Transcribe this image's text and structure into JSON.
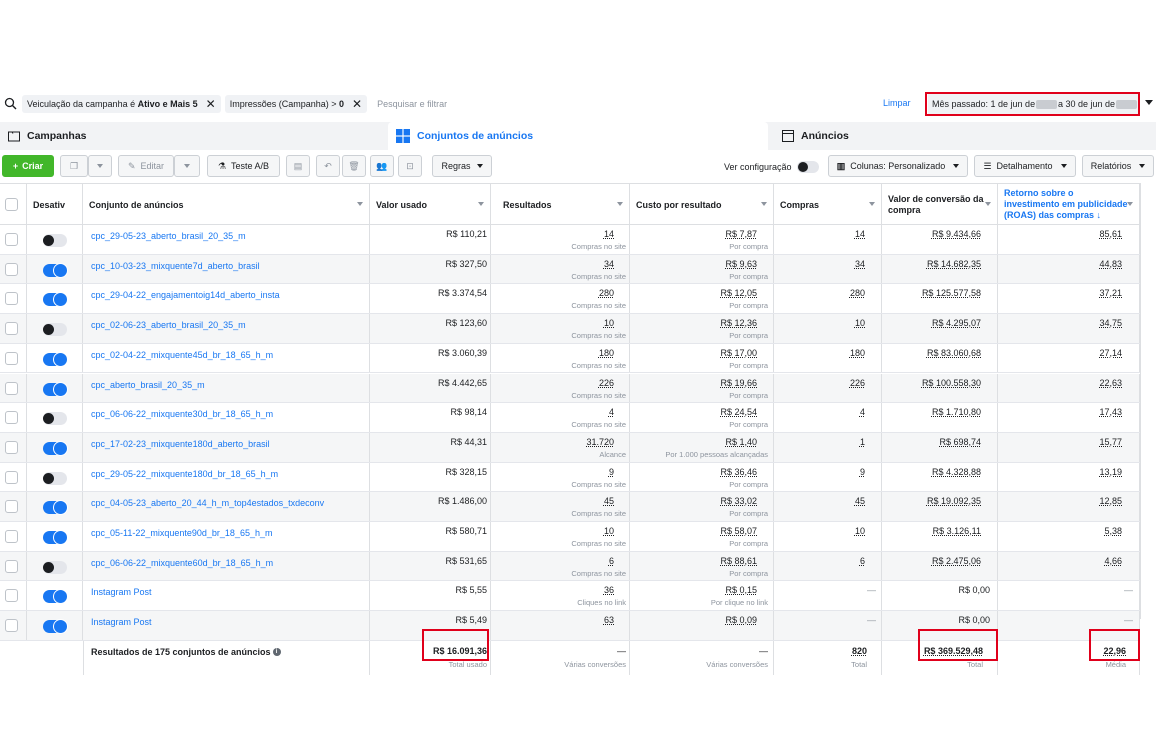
{
  "filters": {
    "chip1_prefix": "Veiculação da campanha é",
    "chip1_bold": "Ativo e Mais 5",
    "chip2_prefix": "Impressões (Campanha) >",
    "chip2_bold": "0",
    "placeholder": "Pesquisar e filtrar",
    "clear_label": "Limpar",
    "date_part1": "Mês passado: 1 de jun de",
    "date_part2": "a 30 de jun de"
  },
  "tabs": [
    {
      "label": "Campanhas"
    },
    {
      "label": "Conjuntos de anúncios"
    },
    {
      "label": "Anúncios"
    }
  ],
  "toolbar": {
    "create": "Criar",
    "edit": "Editar",
    "ab_test": "Teste A/B",
    "rules": "Regras",
    "view_config": "Ver configuração",
    "columns": "Colunas: Personalizado",
    "breakdown": "Detalhamento",
    "reports": "Relatórios"
  },
  "columns": {
    "status": "Desativ",
    "name": "Conjunto de anúncios",
    "spend": "Valor usado",
    "results": "Resultados",
    "cpr": "Custo por resultado",
    "purchases": "Compras",
    "conv_value_1": "Valor de conversão da",
    "conv_value_2": "compra",
    "roas_1": "Retorno sobre o",
    "roas_2": "investimento em publicidade",
    "roas_3": "(ROAS) das compras ↓"
  },
  "rows": [
    {
      "on": false,
      "name": "cpc_29-05-23_aberto_brasil_20_35_m",
      "spend": "R$ 110,21",
      "results": "14",
      "results_sub": "Compras no site",
      "cpr": "R$ 7,87",
      "cpr_sub": "Por compra",
      "purchases": "14",
      "conv": "R$ 9.434,66",
      "roas": "85,61"
    },
    {
      "on": true,
      "name": "cpc_10-03-23_mixquente7d_aberto_brasil",
      "spend": "R$ 327,50",
      "results": "34",
      "results_sub": "Compras no site",
      "cpr": "R$ 9,63",
      "cpr_sub": "Por compra",
      "purchases": "34",
      "conv": "R$ 14.682,35",
      "roas": "44,83"
    },
    {
      "on": true,
      "name": "cpc_29-04-22_engajamentoig14d_aberto_insta",
      "spend": "R$ 3.374,54",
      "results": "280",
      "results_sub": "Compras no site",
      "cpr": "R$ 12,05",
      "cpr_sub": "Por compra",
      "purchases": "280",
      "conv": "R$ 125.577,58",
      "roas": "37,21"
    },
    {
      "on": false,
      "name": "cpc_02-06-23_aberto_brasil_20_35_m",
      "spend": "R$ 123,60",
      "results": "10",
      "results_sub": "Compras no site",
      "cpr": "R$ 12,36",
      "cpr_sub": "Por compra",
      "purchases": "10",
      "conv": "R$ 4.295,07",
      "roas": "34,75"
    },
    {
      "on": true,
      "name": "cpc_02-04-22_mixquente45d_br_18_65_h_m",
      "spend": "R$ 3.060,39",
      "results": "180",
      "results_sub": "Compras no site",
      "cpr": "R$ 17,00",
      "cpr_sub": "Por compra",
      "purchases": "180",
      "conv": "R$ 83.060,68",
      "roas": "27,14"
    },
    {
      "on": true,
      "name": "cpc_aberto_brasil_20_35_m",
      "spend": "R$ 4.442,65",
      "results": "226",
      "results_sub": "Compras no site",
      "cpr": "R$ 19,66",
      "cpr_sub": "Por compra",
      "purchases": "226",
      "conv": "R$ 100.558,30",
      "roas": "22,63"
    },
    {
      "on": false,
      "name": "cpc_06-06-22_mixquente30d_br_18_65_h_m",
      "spend": "R$ 98,14",
      "results": "4",
      "results_sub": "Compras no site",
      "cpr": "R$ 24,54",
      "cpr_sub": "Por compra",
      "purchases": "4",
      "conv": "R$ 1.710,80",
      "roas": "17,43"
    },
    {
      "on": true,
      "name": "cpc_17-02-23_mixquente180d_aberto_brasil",
      "spend": "R$ 44,31",
      "results": "31.720",
      "results_sub": "Alcance",
      "cpr": "R$ 1,40",
      "cpr_sub": "Por 1.000 pessoas alcançadas",
      "purchases": "1",
      "conv": "R$ 698,74",
      "roas": "15,77"
    },
    {
      "on": false,
      "name": "cpc_29-05-22_mixquente180d_br_18_65_h_m",
      "spend": "R$ 328,15",
      "results": "9",
      "results_sub": "Compras no site",
      "cpr": "R$ 36,46",
      "cpr_sub": "Por compra",
      "purchases": "9",
      "conv": "R$ 4.328,88",
      "roas": "13,19"
    },
    {
      "on": true,
      "name": "cpc_04-05-23_aberto_20_44_h_m_top4estados_txdeconv",
      "spend": "R$ 1.486,00",
      "results": "45",
      "results_sub": "Compras no site",
      "cpr": "R$ 33,02",
      "cpr_sub": "Por compra",
      "purchases": "45",
      "conv": "R$ 19.092,35",
      "roas": "12,85"
    },
    {
      "on": true,
      "name": "cpc_05-11-22_mixquente90d_br_18_65_h_m",
      "spend": "R$ 580,71",
      "results": "10",
      "results_sub": "Compras no site",
      "cpr": "R$ 58,07",
      "cpr_sub": "Por compra",
      "purchases": "10",
      "conv": "R$ 3.126,11",
      "roas": "5,38"
    },
    {
      "on": false,
      "name": "cpc_06-06-22_mixquente60d_br_18_65_h_m",
      "spend": "R$ 531,65",
      "results": "6",
      "results_sub": "Compras no site",
      "cpr": "R$ 88,61",
      "cpr_sub": "Por compra",
      "purchases": "6",
      "conv": "R$ 2.475,06",
      "roas": "4,66"
    },
    {
      "on": true,
      "name": "Instagram Post",
      "spend": "R$ 5,55",
      "results": "36",
      "results_sub": "Cliques no link",
      "cpr": "R$ 0,15",
      "cpr_sub": "Por clique no link",
      "purchases": "—",
      "conv": "R$ 0,00",
      "roas": "—"
    },
    {
      "on": true,
      "name": "Instagram Post",
      "spend": "R$ 5,49",
      "results": "63",
      "results_sub": "",
      "cpr": "R$ 0,09",
      "cpr_sub": "",
      "purchases": "—",
      "conv": "R$ 0,00",
      "roas": "—"
    }
  ],
  "totals": {
    "label": "Resultados de 175 conjuntos de anúncios",
    "spend": "R$ 16.091,36",
    "spend_sub": "Total usado",
    "results": "—",
    "results_sub": "Várias conversões",
    "cpr": "—",
    "cpr_sub": "Várias conversões",
    "purchases": "820",
    "purchases_sub": "Total",
    "conv": "R$ 369.529,48",
    "conv_sub": "Total",
    "roas": "22,96",
    "roas_sub": "Média"
  },
  "colors": {
    "accent": "#1877f2",
    "create_green": "#42b72a",
    "highlight_red": "#e0001b"
  }
}
